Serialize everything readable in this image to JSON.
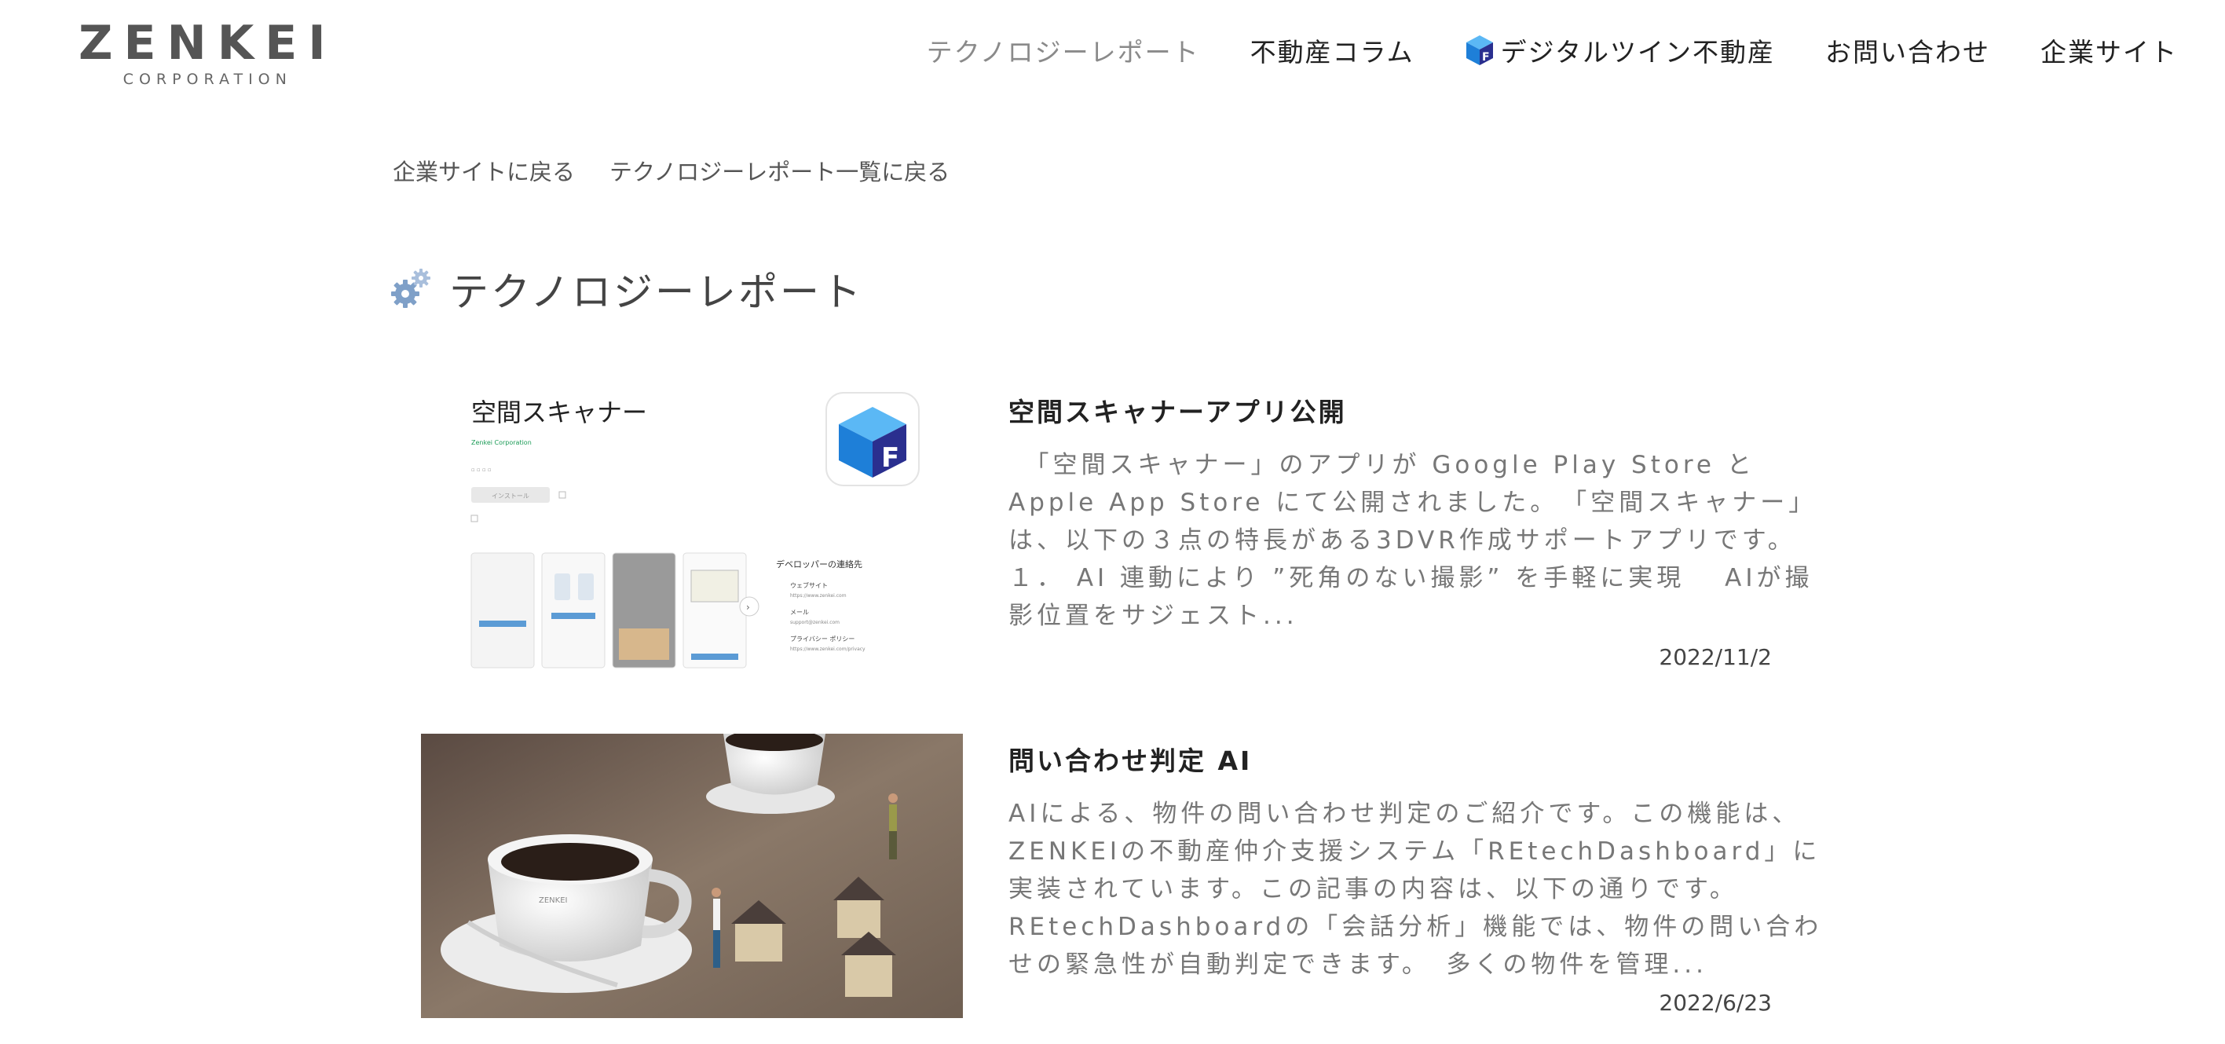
{
  "header": {
    "logo": {
      "name": "ZENKEI",
      "sub": "CORPORATION"
    },
    "nav": [
      {
        "label": "テクノロジーレポート"
      },
      {
        "label": "不動産コラム"
      },
      {
        "label": "デジタルツイン不動産",
        "icon": "digital-twin-icon"
      },
      {
        "label": "お問い合わせ"
      },
      {
        "label": "企業サイト"
      }
    ]
  },
  "breadcrumb": {
    "back_to_corporate": "企業サイトに戻る",
    "back_to_list": "テクノロジーレポート一覧に戻る"
  },
  "page": {
    "title": "テクノロジーレポート",
    "icon": "gear-icon"
  },
  "articles": [
    {
      "title": "空間スキャナーアプリ公開",
      "excerpt": "　「空間スキャナー」のアプリが Google Play Store と Apple App Store にて公開されました。　「空間スキャナー」は、以下の３点の特長がある3DVR作成サポートアプリです。１． AI 連動により ”死角のない撮影” を手軽に実現　 AIが撮影位置をサジェスト...",
      "date": "2022/11/2",
      "thumb": {
        "app_name": "空間スキャナー",
        "developer": "Zenkei Corporation",
        "install": "インストール",
        "contact": "デベロッパーの連絡先",
        "website": "ウェブサイト",
        "website_url": "https://www.zenkei.com",
        "email": "メール",
        "email_addr": "support@zenkei.com",
        "privacy": "プライバシー ポリシー",
        "privacy_url": "https://www.zenkei.com/privacy"
      }
    },
    {
      "title": "問い合わせ判定 AI",
      "excerpt": "AIによる、物件の問い合わせ判定のご紹介です。この機能は、ZENKEIの不動産仲介支援システム「REtechDashboard」に実装されています。この記事の内容は、以下の通りです。REtechDashboardの「会話分析」機能では、物件の問い合わせの緊急性が自動判定できます。　多くの物件を管理...",
      "date": "2022/6/23",
      "thumb": {
        "cup_logo": "ZENKEI"
      }
    }
  ],
  "colors": {
    "brand_blue": "#1a6fc4",
    "nav_active": "#8a8a8a",
    "text": "#333333"
  }
}
